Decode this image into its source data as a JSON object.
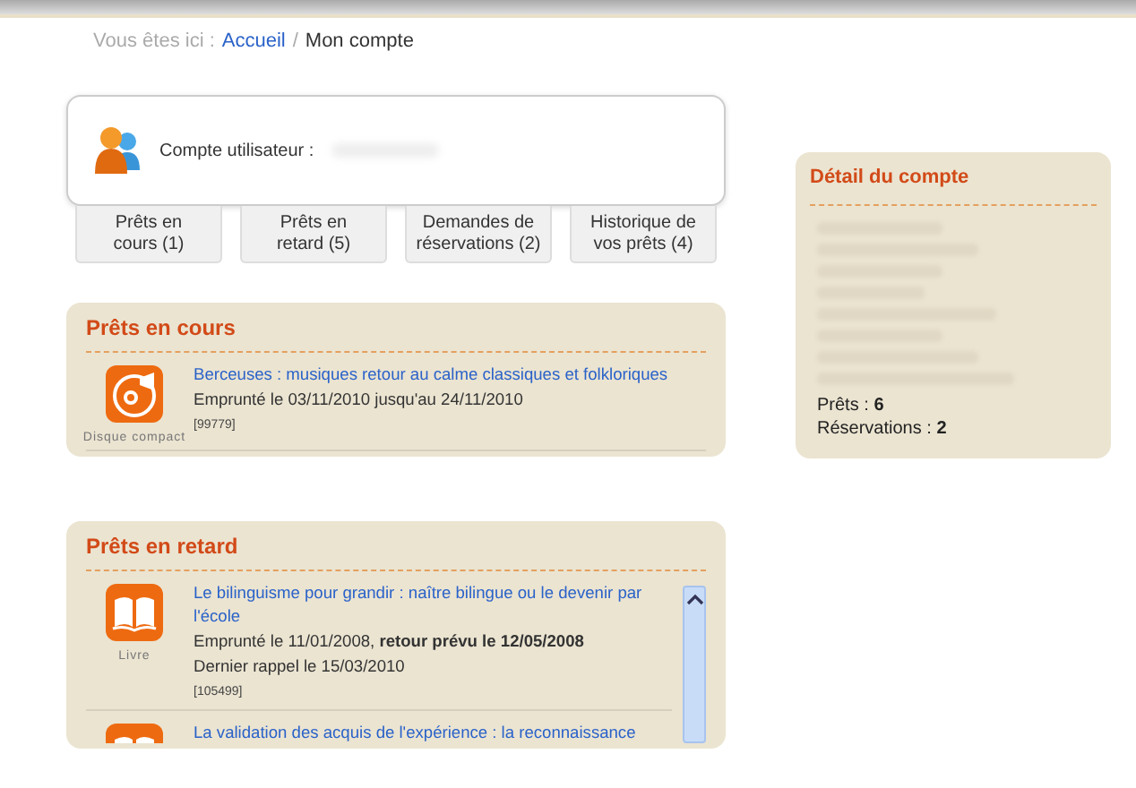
{
  "breadcrumb": {
    "prefix": "Vous êtes ici :",
    "link": "Accueil",
    "separator": "/",
    "current": "Mon compte"
  },
  "account": {
    "label": "Compte utilisateur :"
  },
  "tabs": [
    {
      "label": "Prêts en\ncours (1)"
    },
    {
      "label": "Prêts en\nretard (5)"
    },
    {
      "label": "Demandes de\nréservations (2)"
    },
    {
      "label": "Historique de\nvos prêts (4)"
    }
  ],
  "sections": [
    {
      "title": "Prêts en cours",
      "items": [
        {
          "kind": "cd",
          "type_label": "Disque compact",
          "title": "Berceuses : musiques retour au calme classiques et folkloriques",
          "lines": [
            "Emprunté le 03/11/2010 jusqu'au 24/11/2010"
          ],
          "ref": "[99779]"
        }
      ]
    },
    {
      "title": "Prêts en retard",
      "scrollable": true,
      "items": [
        {
          "kind": "book",
          "type_label": "Livre",
          "title": "Le bilinguisme pour grandir : naître bilingue ou le devenir par l'école",
          "lines": [
            "Emprunté le 11/01/2008, **retour prévu le 12/05/2008**",
            "Dernier rappel le 15/03/2010"
          ],
          "ref": "[105499]"
        },
        {
          "kind": "book",
          "title": "La validation des acquis de l'expérience : la reconnaissance"
        }
      ]
    }
  ],
  "detail": {
    "title": "Détail du compte",
    "stats": [
      {
        "label": "Prêts :",
        "value": "6"
      },
      {
        "label": "Réservations :",
        "value": "2"
      }
    ]
  }
}
